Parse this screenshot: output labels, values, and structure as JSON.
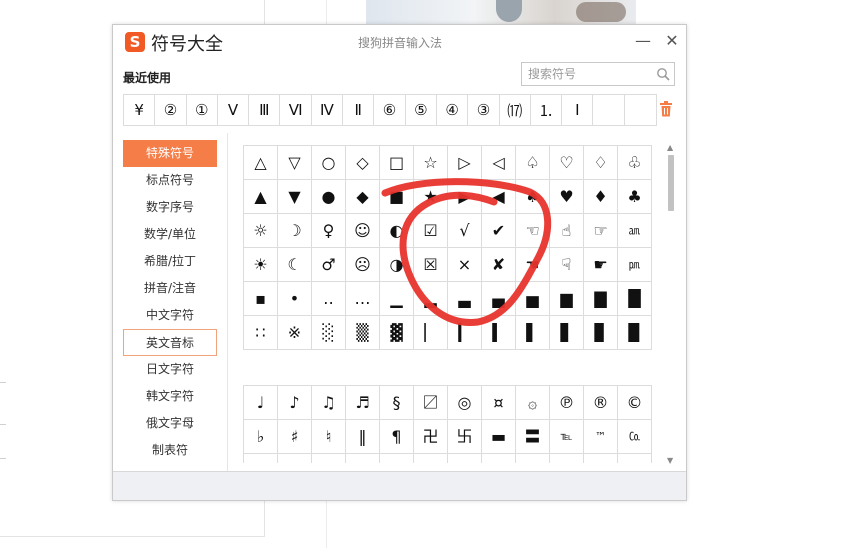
{
  "window": {
    "logo_letter": "S",
    "title": "符号大全",
    "subtitle": "搜狗拼音输入法",
    "minimize_label": "—",
    "close_label": "✕"
  },
  "recent": {
    "label": "最近使用",
    "symbols": [
      "¥",
      "②",
      "①",
      "Ⅴ",
      "Ⅲ",
      "Ⅵ",
      "Ⅳ",
      "Ⅱ",
      "⑥",
      "⑤",
      "④",
      "③",
      "⒄",
      "⒈",
      "Ⅰ",
      "",
      ""
    ]
  },
  "search": {
    "placeholder": "搜索符号"
  },
  "sidebar": {
    "items": [
      {
        "label": "特殊符号"
      },
      {
        "label": "标点符号"
      },
      {
        "label": "数字序号"
      },
      {
        "label": "数学/单位"
      },
      {
        "label": "希腊/拉丁"
      },
      {
        "label": "拼音/注音"
      },
      {
        "label": "中文字符"
      },
      {
        "label": "英文音标"
      },
      {
        "label": "日文字符"
      },
      {
        "label": "韩文字符"
      },
      {
        "label": "俄文字母"
      },
      {
        "label": "制表符"
      }
    ]
  },
  "grid1": [
    [
      "△",
      "▽",
      "○",
      "◇",
      "□",
      "☆",
      "▷",
      "◁",
      "♤",
      "♡",
      "♢",
      "♧"
    ],
    [
      "▲",
      "▼",
      "●",
      "◆",
      "■",
      "★",
      "▶",
      "◀",
      "♠",
      "♥",
      "♦",
      "♣"
    ],
    [
      "☼",
      "☽",
      "♀",
      "☺",
      "◐",
      "☑",
      "√",
      "✔",
      "☜",
      "☝",
      "☞",
      "㏂"
    ],
    [
      "☀",
      "☾",
      "♂",
      "☹",
      "◑",
      "☒",
      "×",
      "✘",
      "☚",
      "☟",
      "☛",
      "㏘"
    ],
    [
      "▪",
      "•",
      "‥",
      "…",
      "▁",
      "▂",
      "▃",
      "▄",
      "▅",
      "▆",
      "▇",
      "█"
    ],
    [
      "∷",
      "※",
      "░",
      "▒",
      "▓",
      "▏",
      "▎",
      "▍",
      "▌",
      "▋",
      "▊",
      "▉"
    ]
  ],
  "grid2": [
    [
      "♩",
      "♪",
      "♫",
      "♬",
      "§",
      "〼",
      "◎",
      "¤",
      "۞",
      "℗",
      "®",
      "©"
    ],
    [
      "♭",
      "♯",
      "♮",
      "‖",
      "¶",
      "卍",
      "卐",
      "▬",
      "〓",
      "℡",
      "™",
      "㏇"
    ],
    [
      "",
      "",
      "",
      "",
      "",
      "",
      "",
      "",
      "",
      "",
      "",
      ""
    ]
  ],
  "colors": {
    "accent": "#f47d48",
    "logo": "#f15a24",
    "annotation": "#e8342c",
    "grid_border": "#dcdcdc"
  },
  "icons": {
    "search": "magnifier-icon",
    "trash": "trash-icon"
  }
}
